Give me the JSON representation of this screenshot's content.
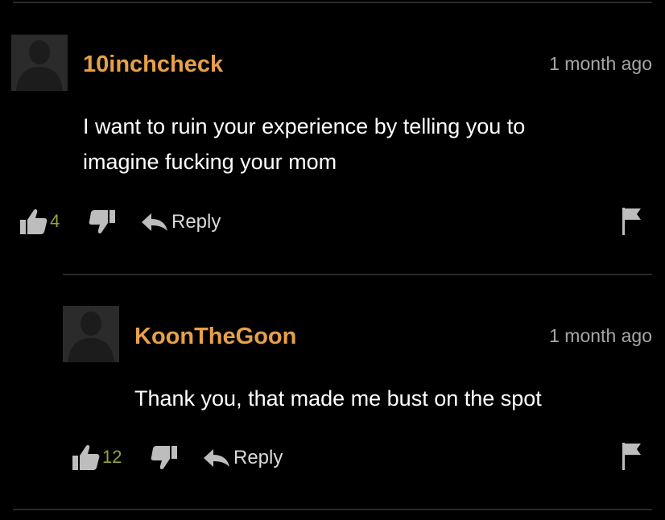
{
  "colors": {
    "background": "#000000",
    "username": "#e8a048",
    "vote_count": "#8fa63d",
    "timestamp": "#a6a6a6",
    "text": "#ffffff",
    "icons": "#bdbdbd",
    "divider": "#2a2a2a"
  },
  "comments": [
    {
      "username": "10inchcheck",
      "timestamp": "1 month ago",
      "text_lines": [
        "I want to ruin your experience by telling you to",
        "imagine fucking your mom"
      ],
      "likes": "4",
      "reply_label": "Reply",
      "icons": [
        "avatar-placeholder-icon",
        "thumbs-up-icon",
        "thumbs-down-icon",
        "reply-arrow-icon",
        "flag-icon"
      ]
    },
    {
      "username": "KoonTheGoon",
      "timestamp": "1 month ago",
      "text_lines": [
        "Thank you, that made me bust on the spot"
      ],
      "likes": "12",
      "reply_label": "Reply",
      "icons": [
        "avatar-placeholder-icon",
        "thumbs-up-icon",
        "thumbs-down-icon",
        "reply-arrow-icon",
        "flag-icon"
      ]
    }
  ]
}
